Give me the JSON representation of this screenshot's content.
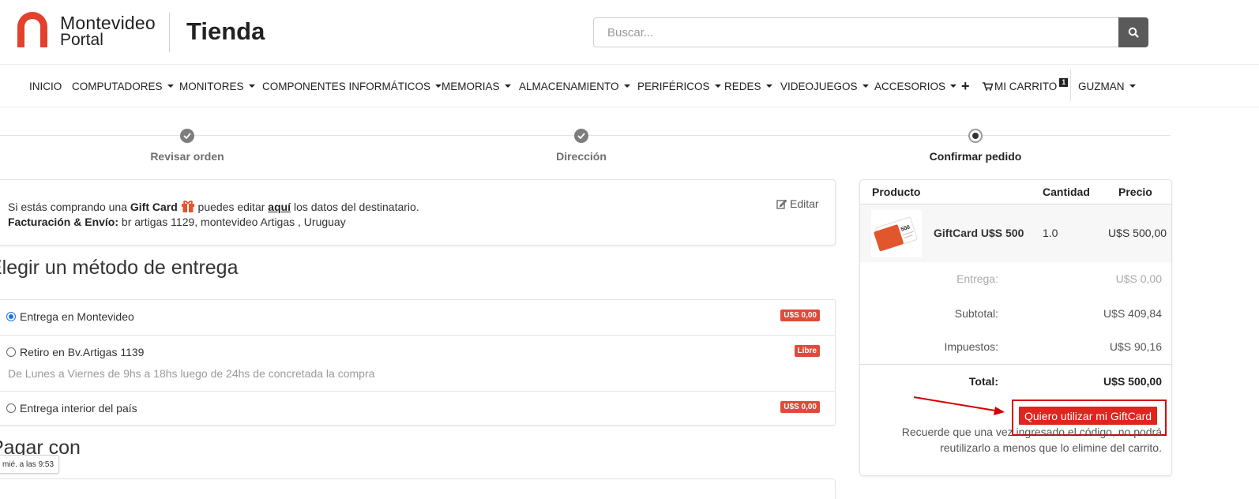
{
  "header": {
    "brand_line1": "Montevideo",
    "brand_line2": "Portal",
    "store_title": "Tienda",
    "search_placeholder": "Buscar...",
    "search_icon": "search-icon",
    "brand_color": "#e2412e"
  },
  "nav": {
    "items": [
      {
        "label": "INICIO"
      },
      {
        "label": "COMPUTADORES"
      },
      {
        "label": "MONITORES"
      },
      {
        "label": "COMPONENTES INFORMÁTICOS"
      },
      {
        "label": "MEMORIAS"
      },
      {
        "label": "ALMACENAMIENTO"
      },
      {
        "label": "PERIFÉRICOS"
      },
      {
        "label": "REDES"
      },
      {
        "label": "VIDEOJUEGOS"
      },
      {
        "label": "ACCESORIOS"
      }
    ],
    "plus_label": "+",
    "cart_label": "MI CARRITO",
    "cart_count": "1",
    "user_label": "GUZMAN"
  },
  "steps": [
    {
      "label": "Revisar orden",
      "state": "done"
    },
    {
      "label": "Dirección",
      "state": "done"
    },
    {
      "label": "Confirmar pedido",
      "state": "current"
    }
  ],
  "info": {
    "prefix": "Si estás comprando una",
    "gift_card": "Gift Card",
    "middle": "puedes editar",
    "link": "aquí",
    "suffix": "los datos del destinatario.",
    "billing_label": "Facturación & Envío:",
    "billing_value": "br artigas 1129, montevideo Artigas , Uruguay",
    "edit_label": "Editar"
  },
  "delivery": {
    "title": "Elegir un método de entrega",
    "options": [
      {
        "label": "Entrega en Montevideo",
        "badge": "U$S 0,00",
        "selected": true,
        "sub": ""
      },
      {
        "label": "Retiro en Bv.Artigas 1139",
        "badge": "Libre",
        "selected": false,
        "sub": "De Lunes a Viernes de 9hs a 18hs luego de 24hs de concretada la compra"
      },
      {
        "label": "Entrega interior del país",
        "badge": "U$S 0,00",
        "selected": false,
        "sub": ""
      }
    ]
  },
  "payment": {
    "title": "Pagar con",
    "tooltip": "mié. a las 9:53"
  },
  "summary": {
    "col_product": "Producto",
    "col_qty": "Cantidad",
    "col_price": "Precio",
    "product": {
      "name": "GiftCard U$S 500",
      "qty": "1.0",
      "price": "U$S 500,00",
      "image_label": "500"
    },
    "delivery_label": "Entrega:",
    "delivery_value": "U$S 0,00",
    "subtotal_label": "Subtotal:",
    "subtotal_value": "U$S 409,84",
    "tax_label": "Impuestos:",
    "tax_value": "U$S 90,16",
    "total_label": "Total:",
    "total_value": "U$S 500,00",
    "giftcard_button": "Quiero utilizar mi GiftCard",
    "note": "Recuerde que una vez ingresado el código, no podrá reutilizarlo a menos que lo elimine del carrito."
  }
}
